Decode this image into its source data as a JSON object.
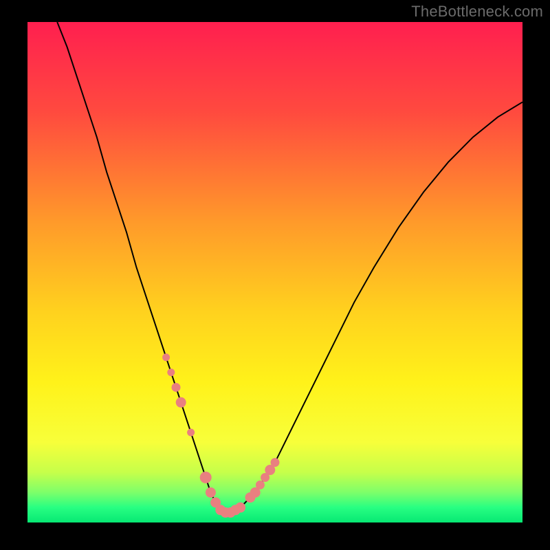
{
  "watermark": "TheBottleneck.com",
  "colors": {
    "frame": "#000000",
    "watermark_text": "#6b6b6b",
    "gradient_stops": [
      {
        "offset": 0.0,
        "color": "#ff1f4f"
      },
      {
        "offset": 0.18,
        "color": "#ff4a3f"
      },
      {
        "offset": 0.4,
        "color": "#ff9a2a"
      },
      {
        "offset": 0.58,
        "color": "#ffd21e"
      },
      {
        "offset": 0.72,
        "color": "#fff21a"
      },
      {
        "offset": 0.84,
        "color": "#f7ff3a"
      },
      {
        "offset": 0.9,
        "color": "#c6ff4a"
      },
      {
        "offset": 0.94,
        "color": "#7dff6a"
      },
      {
        "offset": 0.97,
        "color": "#28ff82"
      },
      {
        "offset": 1.0,
        "color": "#07e873"
      }
    ],
    "curve": "#000000",
    "marker_fill": "#e98080",
    "marker_stroke": "#e98080"
  },
  "chart_data": {
    "type": "line",
    "title": "",
    "xlabel": "",
    "ylabel": "",
    "xlim": [
      0,
      100
    ],
    "ylim": [
      0,
      100
    ],
    "series": [
      {
        "name": "bottleneck-curve",
        "x": [
          6,
          8,
          10,
          12,
          14,
          16,
          18,
          20,
          22,
          24,
          26,
          28,
          30,
          32,
          34,
          35,
          36,
          37,
          38,
          39,
          40,
          41,
          42,
          43,
          44,
          46,
          48,
          50,
          52,
          55,
          58,
          62,
          66,
          70,
          75,
          80,
          85,
          90,
          95,
          100
        ],
        "y": [
          100,
          95,
          89,
          83,
          77,
          70,
          64,
          58,
          51,
          45,
          39,
          33,
          27,
          21,
          15,
          12,
          9,
          6,
          4,
          2.5,
          2,
          2,
          2.5,
          3,
          4,
          6,
          9,
          12,
          16,
          22,
          28,
          36,
          44,
          51,
          59,
          66,
          72,
          77,
          81,
          84
        ]
      }
    ],
    "markers": {
      "name": "highlighted-points",
      "x": [
        28,
        29,
        30,
        31,
        33,
        36,
        37,
        38,
        39,
        40,
        41,
        42,
        43,
        45,
        46,
        47,
        48,
        49,
        50
      ],
      "y": [
        33,
        30,
        27,
        24,
        18,
        9,
        6,
        4,
        2.5,
        2,
        2,
        2.5,
        3,
        5,
        6,
        7.5,
        9,
        10.5,
        12
      ],
      "sizes": [
        5,
        5,
        6,
        7,
        5,
        8,
        7,
        7,
        7,
        7,
        7,
        7,
        7,
        7,
        7,
        6,
        6,
        7,
        6
      ]
    }
  }
}
